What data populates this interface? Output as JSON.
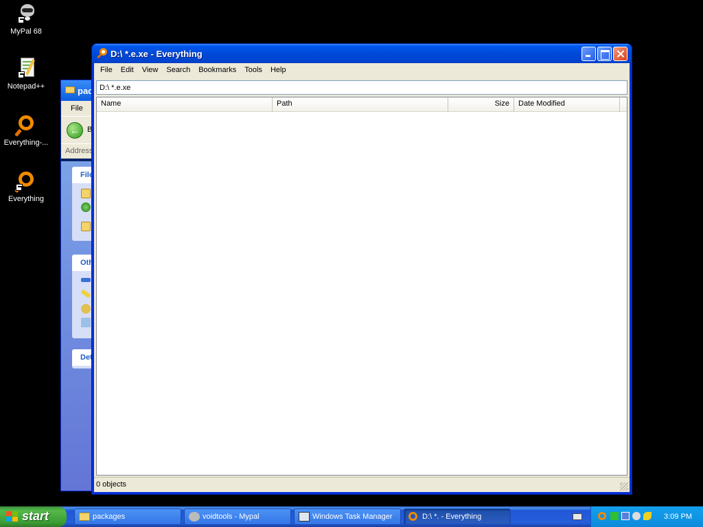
{
  "desktop": {
    "icons": [
      {
        "label": "MyPal 68",
        "icon": "raccoon-icon"
      },
      {
        "label": "Notepad++",
        "icon": "notepad-plus-icon"
      },
      {
        "label": "Everything-...",
        "icon": "everything-magnifier-icon"
      },
      {
        "label": "Everything",
        "icon": "everything-magnifier-icon"
      }
    ]
  },
  "explorer": {
    "title": "pac",
    "menu_file": "File",
    "back_label": "B",
    "address_label": "Address",
    "box1_header": "File",
    "box2_header": "Oth",
    "box3_header": "Det"
  },
  "everything": {
    "title": "D:\\ *.e.xe - Everything",
    "menu": [
      "File",
      "Edit",
      "View",
      "Search",
      "Bookmarks",
      "Tools",
      "Help"
    ],
    "search_value": "D:\\ *.e.xe",
    "columns": [
      "Name",
      "Path",
      "Size",
      "Date Modified"
    ],
    "status": "0 objects"
  },
  "taskbar": {
    "start_label": "start",
    "tasks": [
      {
        "label": "packages",
        "icon": "folder-icon"
      },
      {
        "label": "voidtools - Mypal",
        "icon": "mypal-icon"
      },
      {
        "label": "Windows Task Manager",
        "icon": "task-manager-icon"
      },
      {
        "label": "D:\\ *. - Everything",
        "icon": "everything-magnifier-icon"
      }
    ],
    "clock": "3:09 PM"
  },
  "colors": {
    "xp_blue": "#0054e3",
    "taskbar_blue": "#245edb",
    "start_green": "#3a9c33",
    "tray_blue": "#0d8adb",
    "everything_orange": "#f08a00"
  }
}
